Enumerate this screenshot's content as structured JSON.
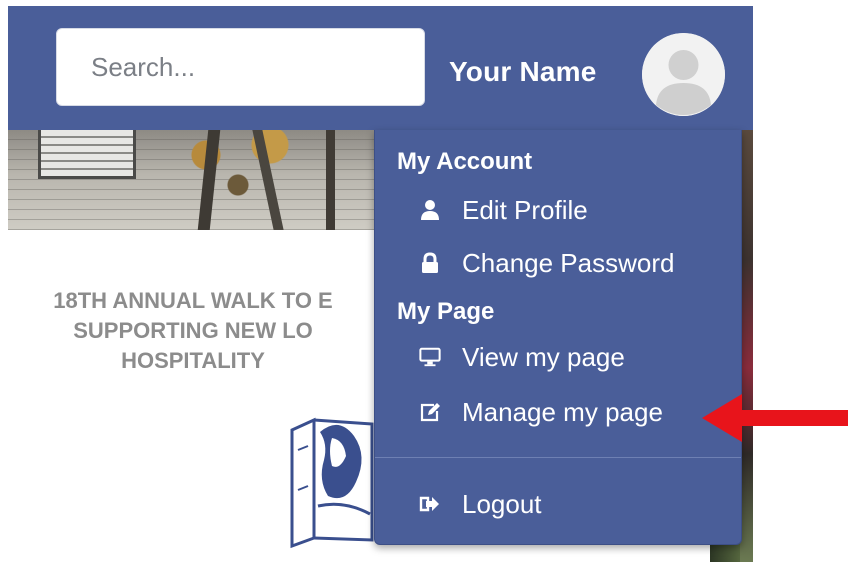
{
  "header": {
    "search_placeholder": "Search...",
    "user_name": "Your Name",
    "avatar_icon": "user-avatar-icon"
  },
  "page": {
    "event_title": "18TH ANNUAL WALK TO E\nSUPPORTING NEW LO\nHOSPITALITY"
  },
  "account_menu": {
    "sections": [
      {
        "title": "My Account",
        "items": [
          {
            "label": "Edit Profile",
            "icon": "user-icon"
          },
          {
            "label": "Change Password",
            "icon": "lock-icon"
          }
        ]
      },
      {
        "title": "My Page",
        "items": [
          {
            "label": "View my page",
            "icon": "desktop-icon"
          },
          {
            "label": "Manage my page",
            "icon": "edit-icon"
          }
        ]
      }
    ],
    "logout_label": "Logout",
    "logout_icon": "sign-out-icon"
  },
  "colors": {
    "header_bg": "#4a5e99",
    "menu_text": "#ffffff",
    "annotation_arrow": "#e8141b"
  },
  "annotation": {
    "icon": "red-arrow-icon"
  }
}
